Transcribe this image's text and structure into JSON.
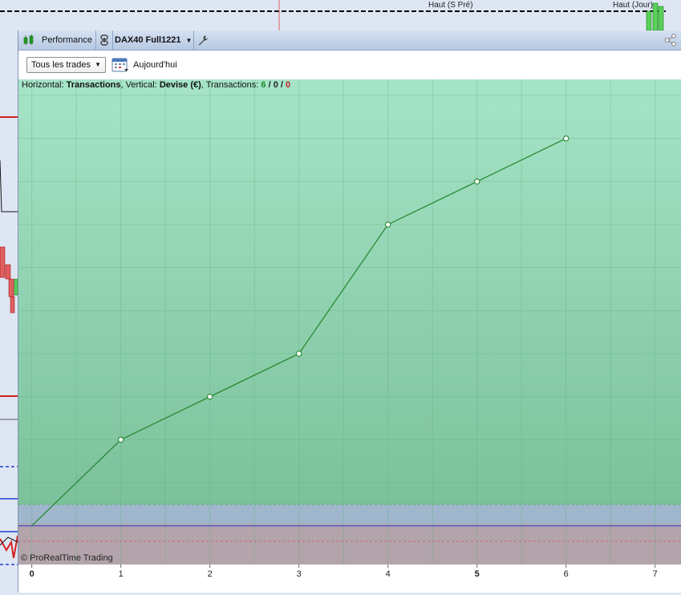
{
  "background_chart": {
    "labels": [
      "Haut (S Pré)",
      "Haut (Jour)"
    ]
  },
  "panel": {
    "title": "Performance",
    "strategy": "DAX40 Full1221",
    "filter": {
      "selected": "Tous les trades"
    },
    "date_button": "Aujourd'hui",
    "header": {
      "h_label": "Horizontal:",
      "h_value": "Transactions",
      "v_label": ", Vertical:",
      "v_value": "Devise (€)",
      "t_label": ", Transactions:",
      "wins": "6",
      "sep1": " / ",
      "neutral": "0",
      "sep2": " / ",
      "losses": "0"
    },
    "copyright": "© ProRealTime Trading"
  },
  "colors": {
    "line": "#2f8f3a",
    "panel_top": "#a6e4c8",
    "panel_bottom": "#7cc19b",
    "zero_line": "#1f3fd6"
  },
  "chart_data": {
    "type": "line",
    "x": [
      0,
      1,
      2,
      3,
      4,
      5,
      6
    ],
    "values": [
      0,
      1,
      1.5,
      2,
      3.5,
      4,
      4.5
    ],
    "xlim": [
      -0.15,
      7.3
    ],
    "ylim": [
      -0.45,
      5.0
    ],
    "xticks": [
      "0",
      "1",
      "2",
      "3",
      "4",
      "5",
      "6",
      "7"
    ],
    "grid": true
  }
}
